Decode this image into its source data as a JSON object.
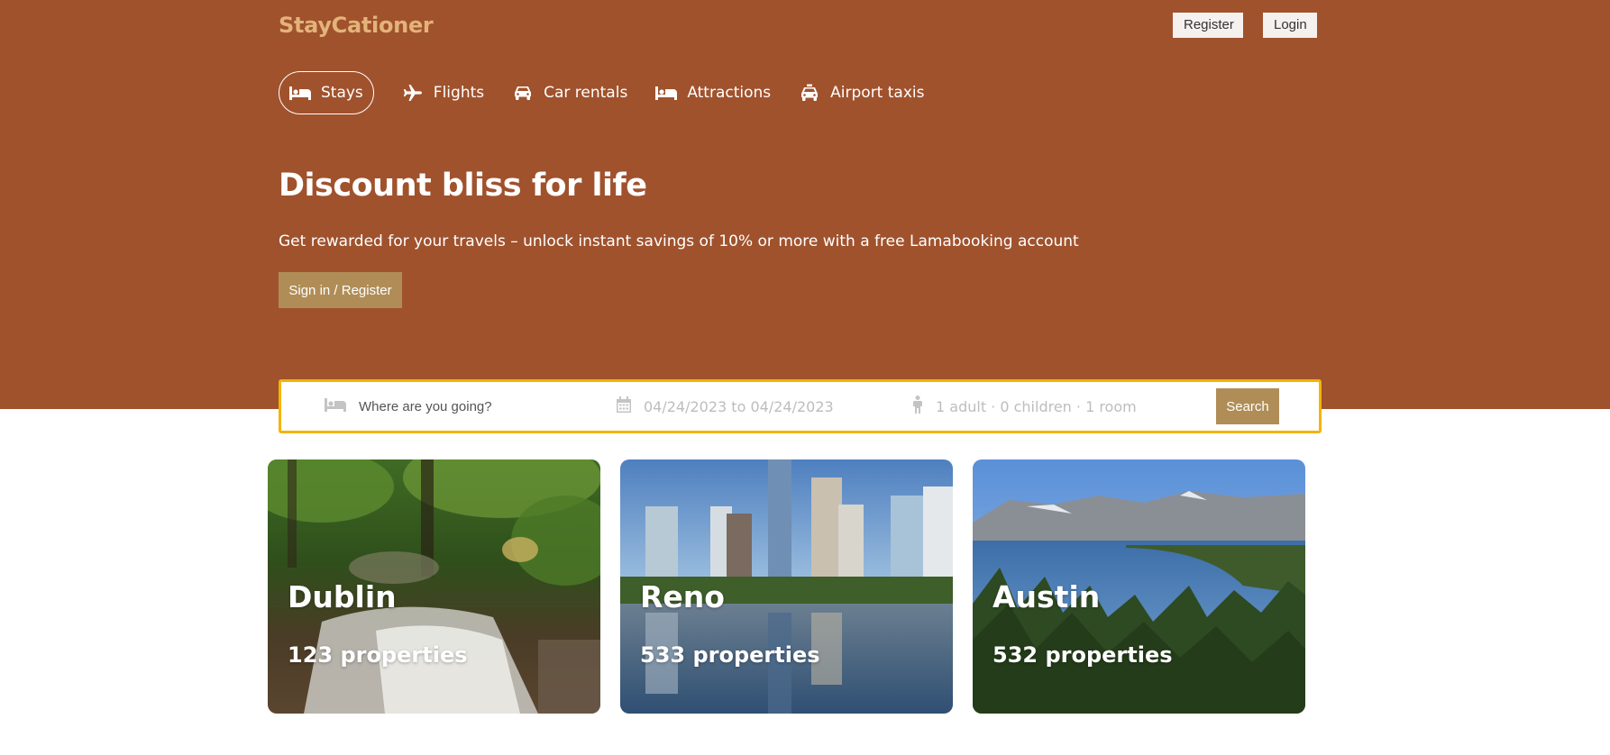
{
  "brand": {
    "logo": "StayCationer"
  },
  "auth": {
    "register_label": "Register",
    "login_label": "Login"
  },
  "nav": {
    "items": [
      {
        "label": "Stays",
        "icon": "bed-icon",
        "active": true
      },
      {
        "label": "Flights",
        "icon": "plane-icon",
        "active": false
      },
      {
        "label": "Car rentals",
        "icon": "car-icon",
        "active": false
      },
      {
        "label": "Attractions",
        "icon": "bed-icon",
        "active": false
      },
      {
        "label": "Airport taxis",
        "icon": "taxi-icon",
        "active": false
      }
    ]
  },
  "hero": {
    "title": "Discount bliss for life",
    "description": "Get rewarded for your travels – unlock instant savings of 10% or more with a free Lamabooking account",
    "cta_label": "Sign in / Register"
  },
  "search": {
    "destination_placeholder": "Where are you going?",
    "date_range": "04/24/2023 to 04/24/2023",
    "guests": "1 adult · 0 children · 1 room",
    "button_label": "Search"
  },
  "featured": [
    {
      "city": "Dublin",
      "properties": "123 properties",
      "image": "forest-waterfall"
    },
    {
      "city": "Reno",
      "properties": "533 properties",
      "image": "city-skyline-lake"
    },
    {
      "city": "Austin",
      "properties": "532 properties",
      "image": "lake-mountains-pines"
    }
  ],
  "colors": {
    "header_bg": "#a0522d",
    "logo": "#e3b37a",
    "accent_button": "#b08d57",
    "search_border": "#f4b400"
  }
}
